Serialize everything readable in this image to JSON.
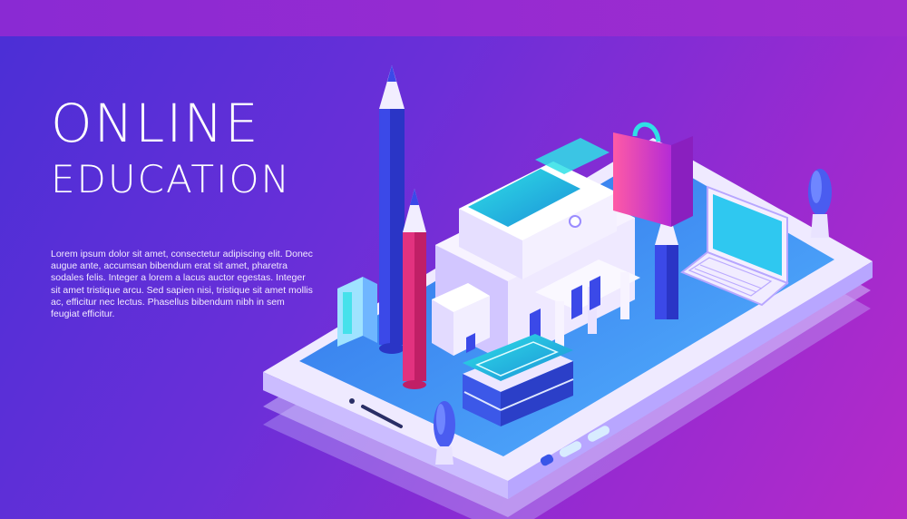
{
  "banner": {
    "title_line1": "ONLINE",
    "title_line2": "EDUCATION",
    "body": "Lorem ipsum dolor sit amet, consectetur adipiscing elit. Donec augue ante, accumsan bibendum erat sit amet, pharetra sodales felis. Integer a lorem a lacus auctor egestas. Integer sit amet tristique arcu. Sed sapien nisi, tristique sit amet mollis ac, efficitur nec lectus. Phasellus bibendum nibh in sem feugiat efficitur."
  },
  "colors": {
    "background_start": "#4a2fd6",
    "background_end": "#b52ac8",
    "phone_body": "#e9e4ff",
    "phone_screen": "#3f8cf2",
    "building": "#ece6ff",
    "accent_cyan": "#2fe0e6",
    "pencil_blue": "#3b49e8",
    "pencil_pink": "#e2327f"
  },
  "illustration": {
    "subject": "isometric-smartphone-with-school-building",
    "objects": [
      "pencil",
      "pencil",
      "pencil",
      "building",
      "books",
      "laptop",
      "shopping-bag",
      "trees",
      "phone"
    ]
  }
}
